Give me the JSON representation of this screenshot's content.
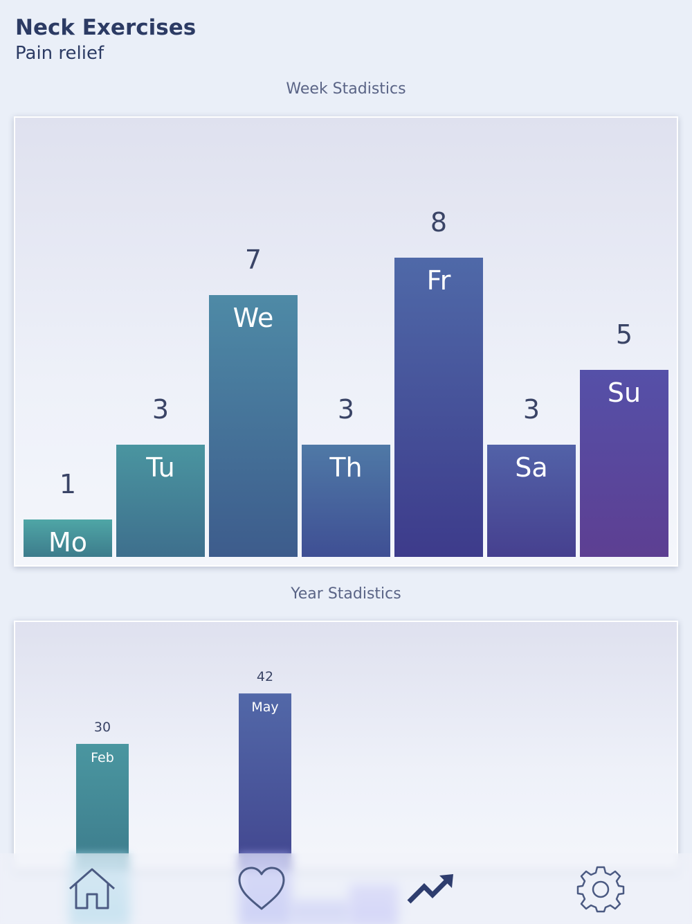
{
  "header": {
    "title": "Neck Exercises",
    "subtitle": "Pain relief"
  },
  "chart_data": [
    {
      "type": "bar",
      "title": "Week Stadistics",
      "categories": [
        "Mo",
        "Tu",
        "We",
        "Th",
        "Fr",
        "Sa",
        "Su"
      ],
      "values": [
        1,
        3,
        7,
        3,
        8,
        3,
        5
      ],
      "ylim": [
        0,
        10
      ],
      "gradient_top": [
        "#4fa6a6",
        "#4a95a0",
        "#4e8aa6",
        "#4f79a6",
        "#4f69a8",
        "#5262a8",
        "#5550a8"
      ],
      "gradient_bottom": [
        "#3d7c8c",
        "#3e6f8d",
        "#3d5c8c",
        "#3f4f94",
        "#3d3b8b",
        "#46408f",
        "#5d3f92"
      ]
    },
    {
      "type": "bar",
      "title": "Year Stadistics",
      "categories": [
        "Feb",
        "May"
      ],
      "values": [
        30,
        42
      ],
      "ylim": [
        0,
        59
      ],
      "gradient_top": [
        "#4a96a0",
        "#5268a8"
      ],
      "gradient_bottom": [
        "#3d7c8c",
        "#42468f"
      ]
    }
  ],
  "tabbar": {
    "items": [
      {
        "name": "home",
        "icon": "home-icon",
        "active_color": "#7ec6de"
      },
      {
        "name": "favorites",
        "icon": "heart-icon",
        "active_color": "#8e95ee"
      },
      {
        "name": "statistics",
        "icon": "trending-up-icon",
        "active_color": "#2e3d6e"
      },
      {
        "name": "settings",
        "icon": "gear-icon",
        "active_color": "#2e3d6e"
      }
    ]
  },
  "colors": {
    "text": "#2c3b64",
    "label": "#3a4466",
    "card_bg": "#eef1f9"
  }
}
